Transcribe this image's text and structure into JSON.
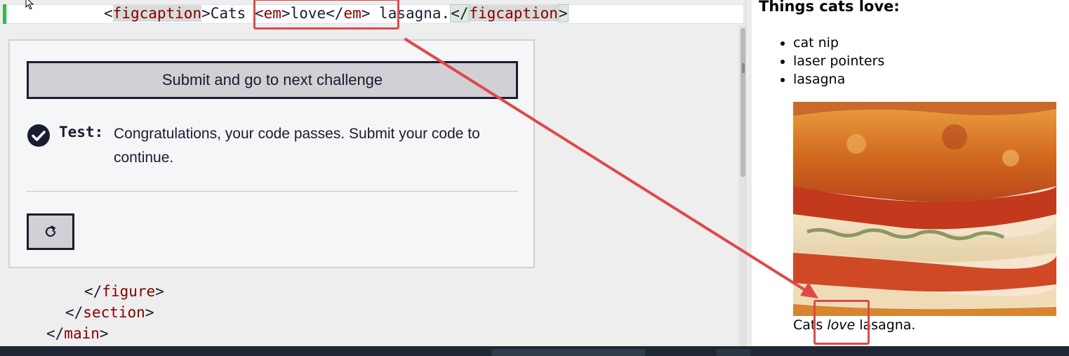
{
  "editor": {
    "line1": {
      "open_tag_lt": "<",
      "open_tag_name": "figcaption",
      "open_tag_gt": ">",
      "text_before": "Cats ",
      "em_open": "<em>",
      "em_text": "love",
      "em_close": "</em>",
      "text_after": " lasagna.",
      "close_tag_lt": "</",
      "close_tag_name": "figcaption",
      "close_tag_gt": ">"
    },
    "line2": {
      "lt": "</",
      "name": "figure",
      "gt": ">"
    },
    "line3": {
      "lt": "</",
      "name": "section",
      "gt": ">"
    },
    "line4": {
      "lt": "</",
      "name": "main",
      "gt": ">"
    }
  },
  "test_panel": {
    "submit_label": "Submit and go to next challenge",
    "test_label": "Test:",
    "message": "Congratulations, your code passes. Submit your code to continue.",
    "reset_icon": "refresh-icon",
    "check_icon": "check-circle-icon"
  },
  "preview": {
    "heading": "Things cats love:",
    "list": [
      "cat nip",
      "laser pointers",
      "lasagna"
    ],
    "caption_before": "Cats ",
    "caption_em": "love",
    "caption_after": " lasagna."
  },
  "colors": {
    "accent_annotation": "#e04848",
    "button_bg": "#d0d0d5",
    "text_dark": "#1b1b32",
    "tag_color": "#800000",
    "gutter_green": "#3eb44a"
  }
}
